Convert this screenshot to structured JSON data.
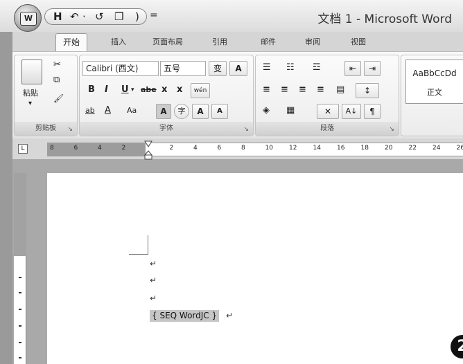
{
  "window": {
    "title": "文档 1 - Microsoft Word"
  },
  "office_button": {
    "icon": "office-logo-icon",
    "label": "W"
  },
  "quick_access": {
    "save_icon": "H",
    "undo_icon": "↶",
    "dropdown": "·",
    "redo_icon": "↺",
    "new_doc_icon": "❐",
    "customize": ")",
    "more": "="
  },
  "tabs": [
    {
      "label": "开始",
      "active": true
    },
    {
      "label": "插入"
    },
    {
      "label": "页面布局"
    },
    {
      "label": "引用"
    },
    {
      "label": "邮件"
    },
    {
      "label": "审阅"
    },
    {
      "label": "视图"
    }
  ],
  "clipboard": {
    "label": "剪贴板",
    "paste_label": "粘贴",
    "paste_arrow": "▾",
    "cut_icon": "✂",
    "copy_icon": "⧉",
    "format_painter_icon": "🖌",
    "launcher": "↘"
  },
  "font": {
    "label": "字体",
    "font_name": "Calibri (西文)",
    "font_size": "五号",
    "change_case": "变",
    "clear_format": "A",
    "bold": "B",
    "italic": "I",
    "underline": "U",
    "underline_arrow": "▾",
    "strikethrough": "abe",
    "subscript": "x",
    "superscript": "x",
    "phonetic_guide": "wén",
    "highlight": "ab",
    "font_color": "A",
    "font_aa": "Aa",
    "char_shading": "A",
    "enclose_char": "字",
    "grow_font": "A",
    "shrink_font": "A",
    "launcher": "↘"
  },
  "paragraph": {
    "label": "段落",
    "bullets": "☰",
    "numbering": "☷",
    "multilevel": "☲",
    "decrease_indent": "⇤",
    "increase_indent": "⇥",
    "align_left": "≡",
    "align_center": "≡",
    "align_right": "≡",
    "justify": "≡",
    "distributed": "▤",
    "line_spacing": "↕",
    "shading": "◈",
    "borders": "▦",
    "chinese_layout": "✕",
    "sort": "A↓",
    "show_marks": "¶",
    "launcher": "↘"
  },
  "styles": {
    "preview": "AaBbCcDd",
    "name": "正文"
  },
  "ruler": {
    "corner": "L",
    "labels": [
      "8",
      "6",
      "4",
      "2",
      "",
      "2",
      "4",
      "6",
      "8",
      "10",
      "12",
      "14",
      "16",
      "18",
      "20",
      "22",
      "24",
      "26"
    ]
  },
  "document": {
    "para_mark": "↵",
    "field_code": "{ SEQ WordJC }"
  },
  "badge": {
    "label": "2"
  }
}
